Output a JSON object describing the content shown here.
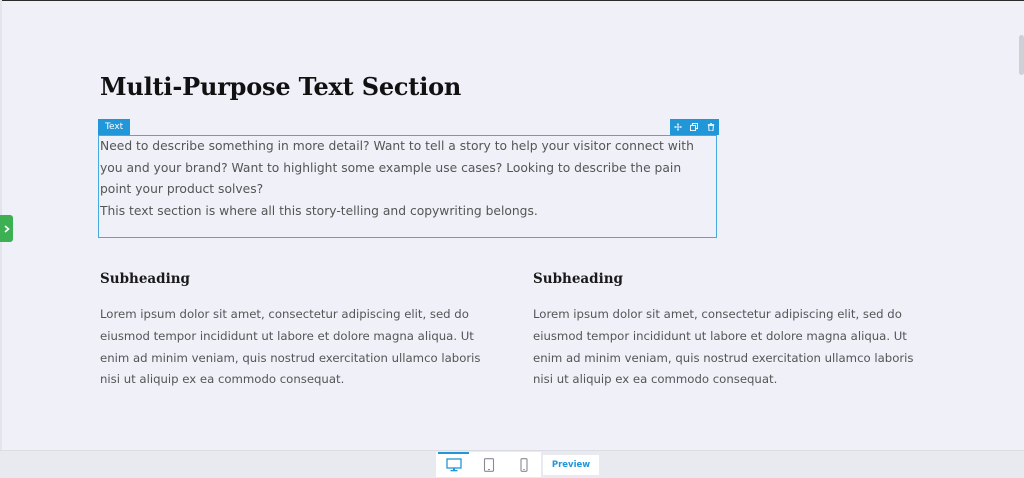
{
  "page": {
    "title": "Multi-Purpose Text Section"
  },
  "module": {
    "tag_label": "Text",
    "paragraphs": [
      "Need to describe something in more detail? Want to tell a story to help your visitor connect with you and your brand? Want to highlight some example use cases? Looking to describe the pain point your product solves?",
      "This text section is where all this story-telling and copywriting belongs."
    ],
    "tools": [
      "move-icon",
      "duplicate-icon",
      "delete-icon"
    ]
  },
  "columns": [
    {
      "heading": "Subheading",
      "body": "Lorem ipsum dolor sit amet, consectetur adipiscing elit, sed do eiusmod tempor incididunt ut labore et dolore magna aliqua. Ut enim ad minim veniam, quis nostrud exercitation ullamco laboris nisi ut aliquip ex ea commodo consequat."
    },
    {
      "heading": "Subheading",
      "body": "Lorem ipsum dolor sit amet, consectetur adipiscing elit, sed do eiusmod tempor incididunt ut labore et dolore magna aliqua. Ut enim ad minim veniam, quis nostrud exercitation ullamco laboris nisi ut aliquip ex ea commodo consequat."
    }
  ],
  "toolbar": {
    "devices": [
      "desktop-icon",
      "tablet-icon",
      "mobile-icon"
    ],
    "active_device": "desktop",
    "preview_label": "Preview"
  },
  "colors": {
    "accent": "#2196d8",
    "side_toggle": "#3cb052",
    "background": "#eff0f8"
  }
}
